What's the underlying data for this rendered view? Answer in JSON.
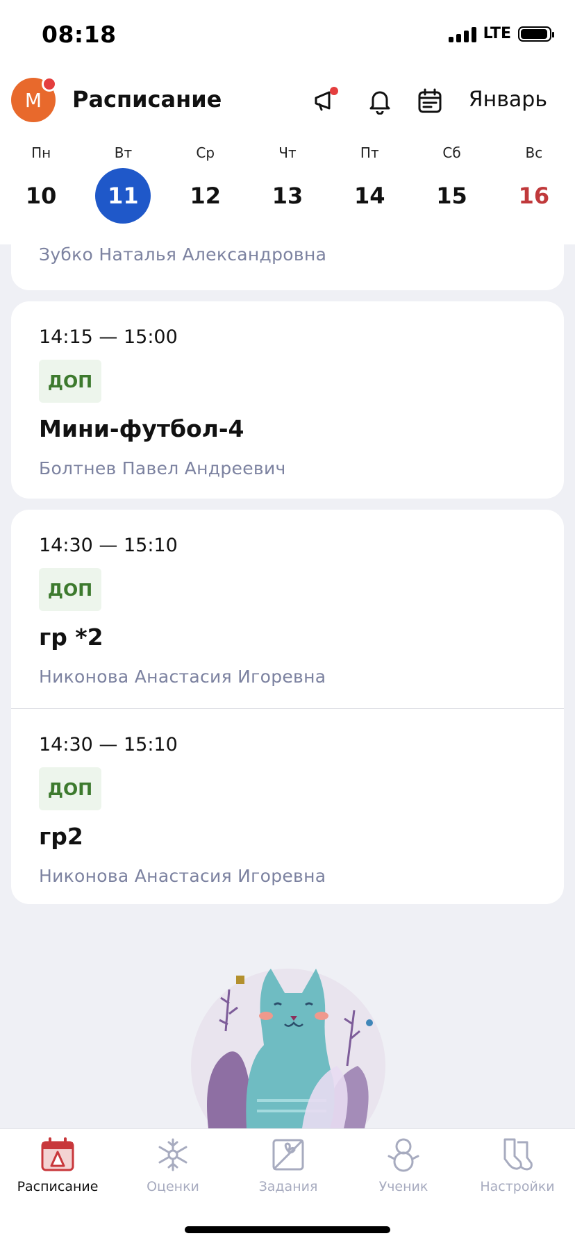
{
  "status": {
    "time": "08:18",
    "network": "LTE"
  },
  "header": {
    "avatar_letter": "М",
    "title": "Расписание",
    "month": "Январь",
    "icons": [
      "megaphone-icon",
      "bell-icon",
      "calendar-icon"
    ]
  },
  "week": [
    {
      "name": "Пн",
      "num": "10"
    },
    {
      "name": "Вт",
      "num": "11",
      "active": true
    },
    {
      "name": "Ср",
      "num": "12"
    },
    {
      "name": "Чт",
      "num": "13"
    },
    {
      "name": "Пт",
      "num": "14"
    },
    {
      "name": "Сб",
      "num": "15"
    },
    {
      "name": "Вс",
      "num": "16",
      "weekend": true
    }
  ],
  "lessons": {
    "partial_teacher": "Зубко Наталья Александровна",
    "items": [
      {
        "time": "14:15 — 15:00",
        "badge": "ДОП",
        "subject": "Мини-футбол-4",
        "teacher": "Болтнев Павел Андреевич"
      },
      {
        "time": "14:30 — 15:10",
        "badge": "ДОП",
        "subject": "гр *2",
        "teacher": "Никонова Анастасия Игоревна"
      },
      {
        "time": "14:30 — 15:10",
        "badge": "ДОП",
        "subject": "гр2",
        "teacher": "Никонова Анастасия Игоревна"
      }
    ]
  },
  "tabs": [
    {
      "label": "Расписание",
      "icon": "calendar-tree-icon",
      "active": true
    },
    {
      "label": "Оценки",
      "icon": "snowflake-icon"
    },
    {
      "label": "Задания",
      "icon": "gift-icon"
    },
    {
      "label": "Ученик",
      "icon": "snowman-icon"
    },
    {
      "label": "Настройки",
      "icon": "socks-icon"
    }
  ],
  "colors": {
    "accent": "#1f58c9",
    "avatar": "#e8692c",
    "weekend": "#c0393b",
    "badge_text": "#3d7a2e",
    "badge_bg": "#edf5ec"
  }
}
